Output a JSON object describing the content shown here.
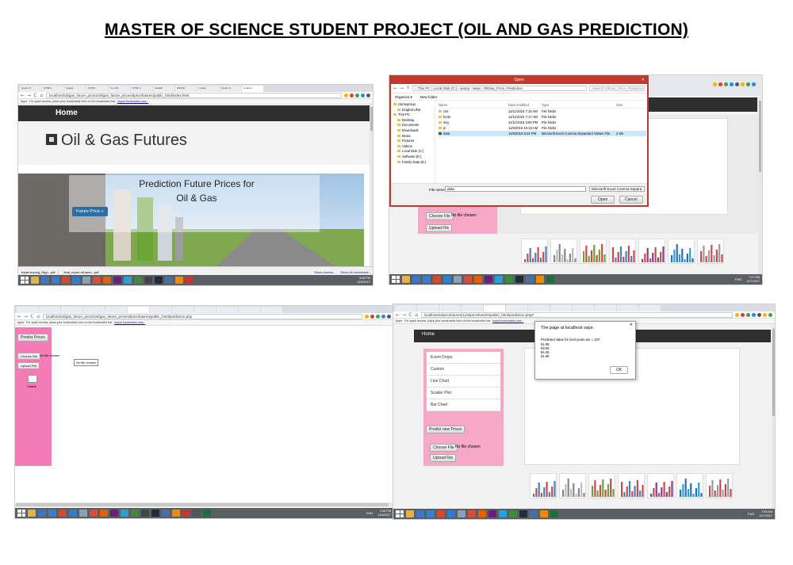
{
  "page_title": "MASTER OF SCIENCE STUDENT PROJECT (OIL AND GAS PREDICTION)",
  "colors": {
    "pink": "#f7a8c7",
    "pink_dark": "#f47bb5",
    "navbar": "#2f2f2f",
    "dialog_border": "#c0392b",
    "taskbar": "#5b5f63"
  },
  "browser": {
    "apps_label": "Apps",
    "bookmarks_hint": "For quick access, place your bookmarks here on the bookmarks bar.",
    "import_link": "Import bookmarks now...",
    "choose_file": "Choose File",
    "no_file": "No file chosen",
    "upload_file": "Upload File"
  },
  "shot1": {
    "tabs": [
      "Queen O",
      "HTML5",
      "Angula",
      "Oil Pric",
      "C++ Bu",
      "HTML C",
      "Installin",
      "OleDbC",
      "Lovely",
      "Queen G",
      "localhos"
    ],
    "url": "localhost/oil/gas_future_price1/oil/gas_future_price/oilpricefutures/public_html/index.html",
    "nav_home": "Home",
    "brand": "Oil & Gas Futures",
    "hero_line1": "Prediction Future Prices for",
    "hero_line2": "Oil & Gas",
    "future_btn": "Future Price »",
    "downloads": [
      "trywe-bryong_Hipp...pdf",
      "final_report-oil-spec...pdf"
    ],
    "show_downloads": "Show downlo...",
    "show_all_downloads": "Show all downloads...",
    "clock_time": "3:38 PM",
    "clock_date": "11/6/2017"
  },
  "shot2": {
    "dialog_title": "Open",
    "breadcrumb": "› This PC › Local Disk (C:) › wamp › www › OilGas_Price_Prediction",
    "search": "Search OilGas_Price_Prediction",
    "organize": "Organize ▾",
    "new_folder": "New folder",
    "columns": [
      "Name",
      "Date modified",
      "Type",
      "Size"
    ],
    "tree": [
      "Homegroup",
      "Ezighal Ufuk",
      "This PC",
      "Desktop",
      "Documents",
      "Downloads",
      "Music",
      "Pictures",
      "Videos",
      "Local Disk (C:)",
      "Software (E:)",
      "Family Data (E:)"
    ],
    "files": [
      {
        "name": "css",
        "date": "11/11/2015 7:15 AM",
        "type": "File folder",
        "size": ""
      },
      {
        "name": "fonts",
        "date": "11/11/2015 7:17 AM",
        "type": "File folder",
        "size": ""
      },
      {
        "name": "img",
        "date": "11/11/2015 3:00 PM",
        "type": "File folder",
        "size": ""
      },
      {
        "name": "js",
        "date": "11/6/2015 10:23 AM",
        "type": "File folder",
        "size": ""
      },
      {
        "name": "data",
        "date": "11/6/2015 8:24 PM",
        "type": "Microsoft Excel Comma Separated Values File",
        "size": "2 KB"
      }
    ],
    "filename_label": "File name:",
    "filename_value": "data",
    "filter": "Microsoft Excel Comma Separa",
    "open_btn": "Open",
    "cancel_btn": "Cancel",
    "clock_time": "7:47 AM",
    "clock_date": "11/7/2017",
    "lang": "ENG"
  },
  "shot3": {
    "url": "localhost/oil/gas_future_price1/oil/gas_future_price/oilpricefutures/public_html/prediction.php",
    "predict_btn": "Predict Prices",
    "tooltip": "No file chosen",
    "charts_label": "Charts",
    "clock_time": "1:28 PM",
    "clock_date": "11/6/2017",
    "lang": "ENG"
  },
  "shot4": {
    "url": "localhost/oilpricefutures(1)/oilpricefutures/public_html/prediction.php#",
    "nav_home": "Home",
    "menu": [
      "Event Drops",
      "Custom",
      "Line Chart",
      "Scatter Plot",
      "Bar Chart"
    ],
    "predict_new_btn": "Predict new Prices",
    "alert_title": "The page at localhost says:",
    "alert_message": "Predicted value for next years are = 107",
    "alert_values": [
      "61.08",
      "69.09",
      "84.45",
      "61.08"
    ],
    "ok_btn": "OK",
    "clock_time": "7:53 AM",
    "clock_date": "11/7/2017",
    "lang": "ENG"
  }
}
